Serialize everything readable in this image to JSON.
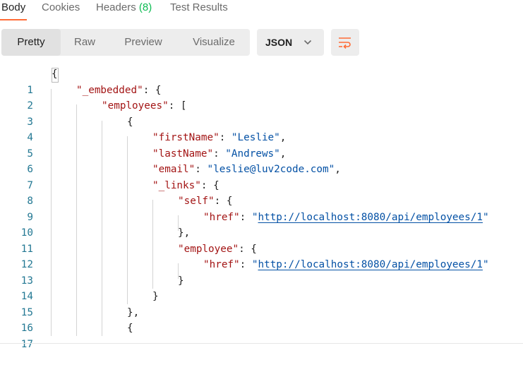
{
  "tabs": [
    {
      "label": "Body"
    },
    {
      "label": "Cookies"
    },
    {
      "label": "Headers",
      "count": "(8)"
    },
    {
      "label": "Test Results"
    }
  ],
  "view_modes": [
    "Pretty",
    "Raw",
    "Preview",
    "Visualize"
  ],
  "active_view_mode": "Pretty",
  "format": {
    "selected": "JSON",
    "icon": "chevron-down-icon"
  },
  "wrap_button": {
    "icon": "wrap-lines-icon"
  },
  "colors": {
    "accent": "#ff6c37",
    "count": "#0cbb52",
    "key": "#a31515",
    "string": "#0451a5",
    "line_number": "#237893"
  },
  "code": {
    "line_numbers": [
      "1",
      "2",
      "3",
      "4",
      "5",
      "6",
      "7",
      "8",
      "9",
      "10",
      "11",
      "12",
      "13",
      "14",
      "15",
      "16",
      "17"
    ],
    "tokens": {
      "l1": "{",
      "l2_key": "\"_embedded\"",
      "l2_rest": ": {",
      "l3_key": "\"employees\"",
      "l3_rest": ": [",
      "l4": "{",
      "l5_key": "\"firstName\"",
      "l5_sep": ": ",
      "l5_val": "\"Leslie\"",
      "l5_end": ",",
      "l6_key": "\"lastName\"",
      "l6_sep": ": ",
      "l6_val": "\"Andrews\"",
      "l6_end": ",",
      "l7_key": "\"email\"",
      "l7_sep": ": ",
      "l7_val": "\"leslie@luv2code.com\"",
      "l7_end": ",",
      "l8_key": "\"_links\"",
      "l8_rest": ": {",
      "l9_key": "\"self\"",
      "l9_rest": ": {",
      "l10_key": "\"href\"",
      "l10_sep": ": ",
      "l10_q1": "\"",
      "l10_url": "http://localhost:8080/api/employees/1",
      "l10_q2": "\"",
      "l11": "},",
      "l12_key": "\"employee\"",
      "l12_rest": ": {",
      "l13_key": "\"href\"",
      "l13_sep": ": ",
      "l13_q1": "\"",
      "l13_url": "http://localhost:8080/api/employees/1",
      "l13_q2": "\"",
      "l14": "}",
      "l15": "}",
      "l16": "},",
      "l17": "{"
    }
  }
}
